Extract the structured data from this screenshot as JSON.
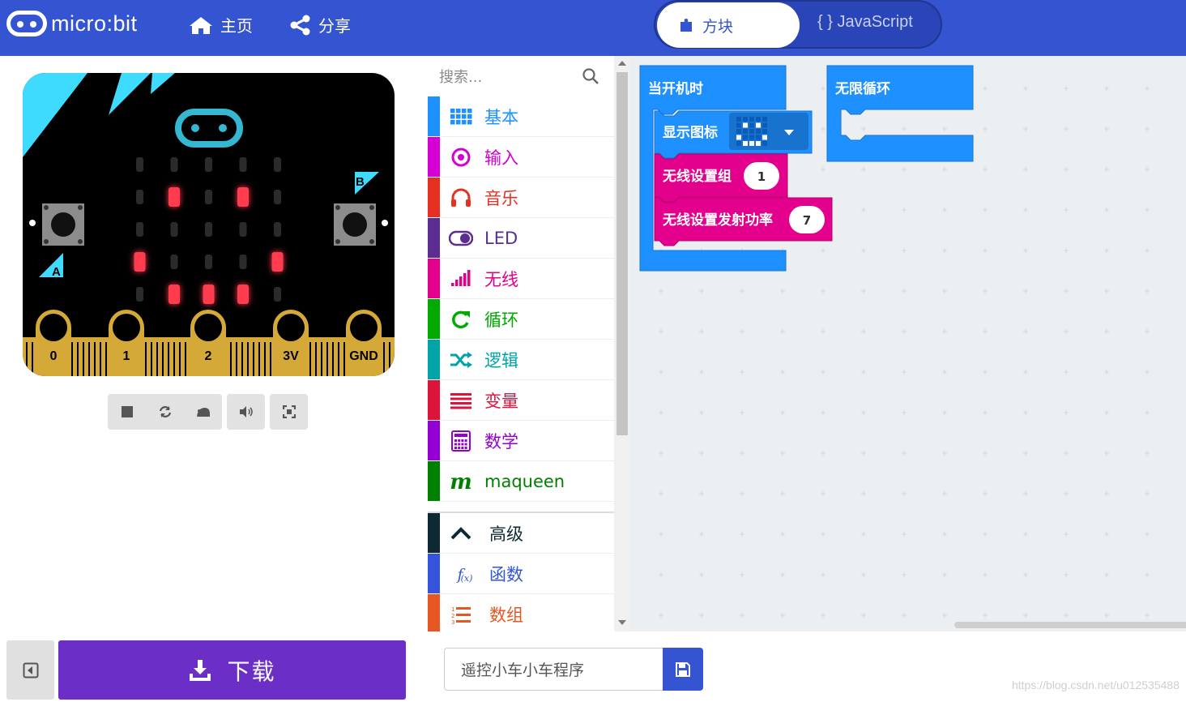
{
  "header": {
    "logo_text": "micro:bit",
    "home_label": "主页",
    "share_label": "分享",
    "mode_blocks_label": "方块",
    "mode_js_label": "{ } JavaScript"
  },
  "simulator": {
    "pin_labels": [
      "0",
      "1",
      "2",
      "3V",
      "GND"
    ],
    "button_a": "A",
    "button_b": "B",
    "led_pattern": [
      [
        0,
        0,
        0,
        0,
        0
      ],
      [
        0,
        1,
        0,
        1,
        0
      ],
      [
        0,
        0,
        0,
        0,
        0
      ],
      [
        1,
        0,
        0,
        0,
        1
      ],
      [
        0,
        1,
        1,
        1,
        0
      ]
    ],
    "led_on_color": "#ff3b4e",
    "led_off_color": "#2b2b2b",
    "controls": [
      "stop-icon",
      "restart-icon",
      "slowmo-icon",
      "mute-icon",
      "fullscreen-icon"
    ]
  },
  "toolbox": {
    "search_placeholder": "搜索...",
    "categories": [
      {
        "label": "基本",
        "color": "#1e90ff",
        "icon": "grid-icon"
      },
      {
        "label": "输入",
        "color": "#d400d4",
        "icon": "input-circle-icon"
      },
      {
        "label": "音乐",
        "color": "#e63022",
        "icon": "headphones-icon"
      },
      {
        "label": "LED",
        "color": "#5c2d91",
        "icon": "toggle-icon"
      },
      {
        "label": "无线",
        "color": "#e3008c",
        "icon": "signal-bars-icon"
      },
      {
        "label": "循环",
        "color": "#00aa00",
        "icon": "refresh-icon"
      },
      {
        "label": "逻辑",
        "color": "#00a4a6",
        "icon": "shuffle-icon"
      },
      {
        "label": "变量",
        "color": "#dc143c",
        "icon": "list-bars-icon"
      },
      {
        "label": "数学",
        "color": "#9400d3",
        "icon": "calculator-icon"
      },
      {
        "label": "maqueen",
        "color": "#008000",
        "icon": "maqueen-m-icon"
      }
    ],
    "advanced": [
      {
        "label": "高级",
        "color": "#0e2933",
        "icon": "chevron-up-icon"
      },
      {
        "label": "函数",
        "color": "#3455db",
        "icon": "function-icon"
      },
      {
        "label": "数组",
        "color": "#e65722",
        "icon": "numbered-list-icon"
      }
    ]
  },
  "workspace": {
    "on_start_label": "当开机时",
    "forever_label": "无限循环",
    "show_icon_label": "显示图标",
    "radio_group_label": "无线设置组",
    "radio_group_value": "1",
    "radio_power_label": "无线设置发射功率",
    "radio_power_value": "7",
    "basic_color": "#1e90ff",
    "radio_color": "#e3008c"
  },
  "footer": {
    "download_label": "下载",
    "project_name": "遥控小车小车程序",
    "watermark": "https://blog.csdn.net/u012535488"
  }
}
